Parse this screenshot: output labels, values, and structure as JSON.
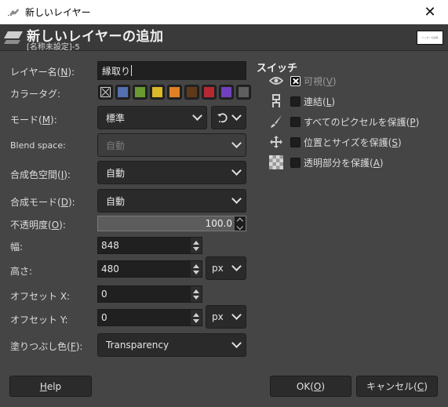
{
  "window": {
    "title": "新しいレイヤー",
    "close_label": "✕"
  },
  "header": {
    "title": "新しいレイヤーの追加",
    "subtitle": "[名称未設定]-5",
    "preview_text": "ヘッダーの画像"
  },
  "form": {
    "layer_name": {
      "label": "レイヤー名(",
      "mnemonic": "N",
      "label_end": "):",
      "value": "縁取り"
    },
    "color_tag": {
      "label": "カラータグ:",
      "options": [
        {
          "name": "none",
          "color": null
        },
        {
          "name": "blue",
          "color": "#5470b0"
        },
        {
          "name": "green",
          "color": "#6a9a30"
        },
        {
          "name": "yellow",
          "color": "#d9b82a"
        },
        {
          "name": "orange",
          "color": "#e08024"
        },
        {
          "name": "brown",
          "color": "#5e3a1a"
        },
        {
          "name": "red",
          "color": "#b82832"
        },
        {
          "name": "violet",
          "color": "#7040c0"
        },
        {
          "name": "gray",
          "color": "#5f5f5f"
        }
      ],
      "selected": "none"
    },
    "mode": {
      "label": "モード(",
      "mnemonic": "M",
      "label_end": "):",
      "value": "標準"
    },
    "blend_space": {
      "label": "Blend space:",
      "value": "自動",
      "disabled": true
    },
    "composite_space": {
      "label": "合成色空間(",
      "mnemonic": "I",
      "label_end": "):",
      "value": "自動"
    },
    "composite_mode": {
      "label": "合成モード(",
      "mnemonic": "D",
      "label_end": "):",
      "value": "自動"
    },
    "opacity": {
      "label": "不透明度(",
      "mnemonic": "O",
      "label_end": "):",
      "value": "100.0",
      "percent": 100
    },
    "width": {
      "label": "幅:",
      "value": "848"
    },
    "height": {
      "label": "高さ:",
      "value": "480"
    },
    "size_unit": "px",
    "offset_x": {
      "label": "オフセット X:",
      "value": "0"
    },
    "offset_y": {
      "label": "オフセット Y:",
      "value": "0"
    },
    "offset_unit": "px",
    "fill": {
      "label": "塗りつぶし色(",
      "mnemonic": "F",
      "label_end": "):",
      "value": "Transparency"
    }
  },
  "switches": {
    "title": "スイッチ",
    "items": [
      {
        "icon": "eye-icon",
        "label": "可視(",
        "mnemonic": "V",
        "label_end": ")",
        "checked": true
      },
      {
        "icon": "chain-link-icon",
        "label": "連結(",
        "mnemonic": "L",
        "label_end": ")",
        "checked": false
      },
      {
        "icon": "paintbrush-icon",
        "label": "すべてのピクセルを保護(",
        "mnemonic": "P",
        "label_end": ")",
        "checked": false
      },
      {
        "icon": "move-arrows-icon",
        "label": "位置とサイズを保護(",
        "mnemonic": "S",
        "label_end": ")",
        "checked": false
      },
      {
        "icon": "checkerboard-icon",
        "label": "透明部分を保護(",
        "mnemonic": "A",
        "label_end": ")",
        "checked": false
      }
    ]
  },
  "buttons": {
    "help": {
      "mnemonic": "H",
      "rest": "elp"
    },
    "ok": {
      "label": "OK(",
      "mnemonic": "O",
      "label_end": ")"
    },
    "cancel": {
      "label": "キャンセル(",
      "mnemonic": "C",
      "label_end": ")"
    }
  }
}
